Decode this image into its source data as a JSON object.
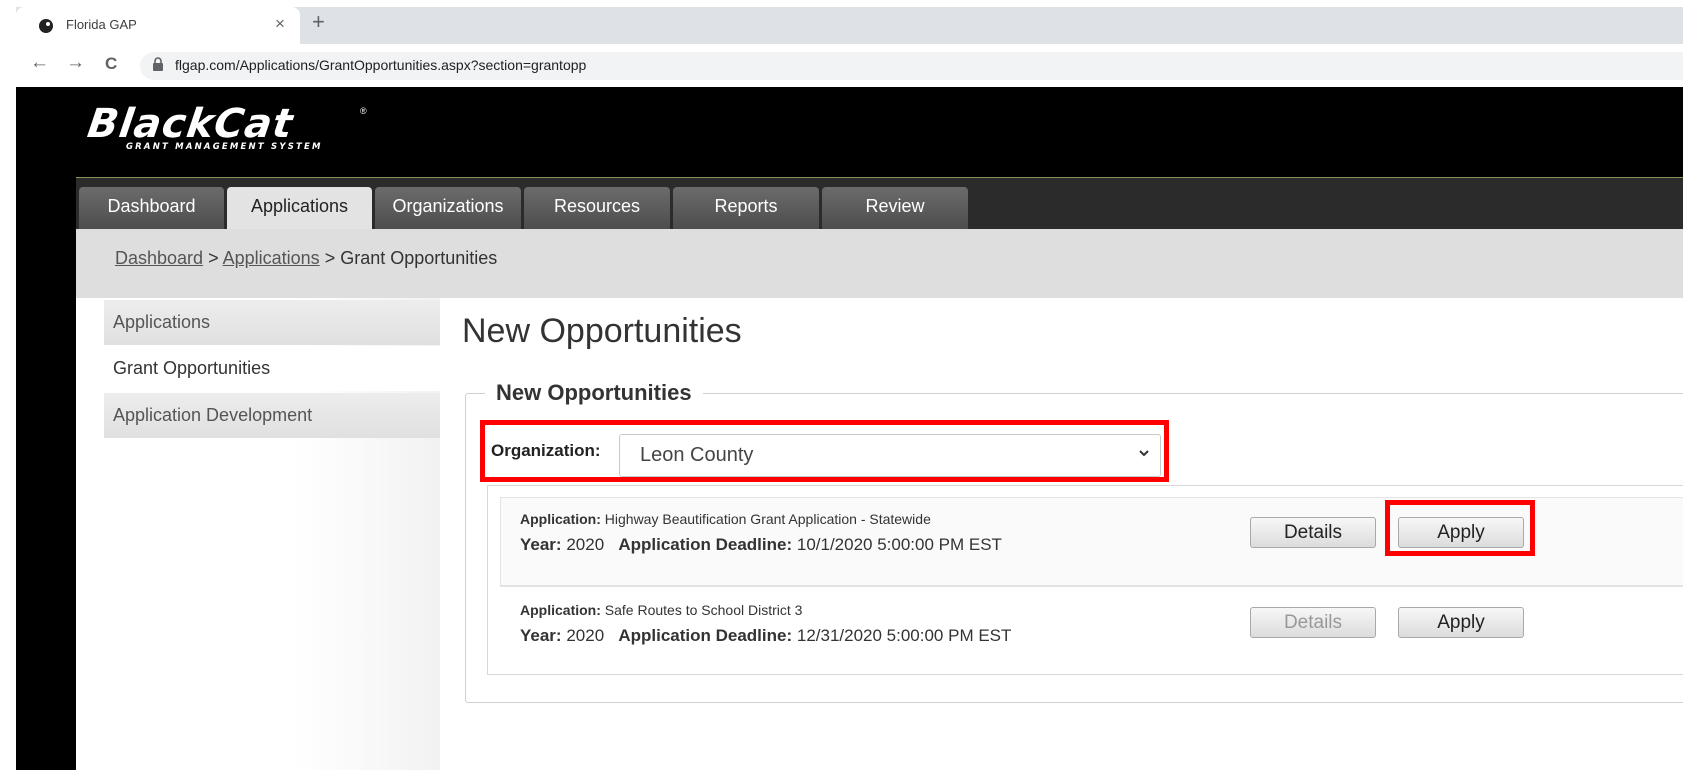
{
  "browser": {
    "tab_title": "Florida GAP",
    "tab_close": "×",
    "new_tab": "+",
    "back": "←",
    "forward": "→",
    "reload": "C",
    "url": "flgap.com/Applications/GrantOpportunities.aspx?section=grantopp"
  },
  "logo": {
    "main": "BlackCat",
    "sub": "GRANT MANAGEMENT SYSTEM",
    "reg": "®"
  },
  "nav": {
    "tabs": [
      {
        "label": "Dashboard"
      },
      {
        "label": "Applications"
      },
      {
        "label": "Organizations"
      },
      {
        "label": "Resources"
      },
      {
        "label": "Reports"
      },
      {
        "label": "Review"
      }
    ],
    "active": "Applications"
  },
  "breadcrumb": {
    "items": [
      "Dashboard",
      "Applications"
    ],
    "separator": ">",
    "current": "Grant Opportunities"
  },
  "sidebar": {
    "items": [
      {
        "label": "Applications"
      },
      {
        "label": "Grant Opportunities"
      },
      {
        "label": "Application Development"
      }
    ]
  },
  "main": {
    "page_title": "New Opportunities",
    "section_title": "New Opportunities",
    "org_label": "Organization:",
    "org_selected": "Leon County",
    "field_labels": {
      "application": "Application:",
      "year": "Year:",
      "deadline": "Application Deadline:"
    },
    "opportunities": [
      {
        "application": "Highway Beautification Grant Application - Statewide",
        "year": "2020",
        "deadline": "10/1/2020 5:00:00 PM EST",
        "details_label": "Details",
        "apply_label": "Apply"
      },
      {
        "application": "Safe Routes to School District 3",
        "year": "2020",
        "deadline": "12/31/2020 5:00:00 PM EST",
        "details_label": "Details",
        "apply_label": "Apply"
      }
    ]
  },
  "colors": {
    "highlight": "#ff0000",
    "header_bg": "#000000",
    "navbar_bg": "#2b2b2b"
  }
}
